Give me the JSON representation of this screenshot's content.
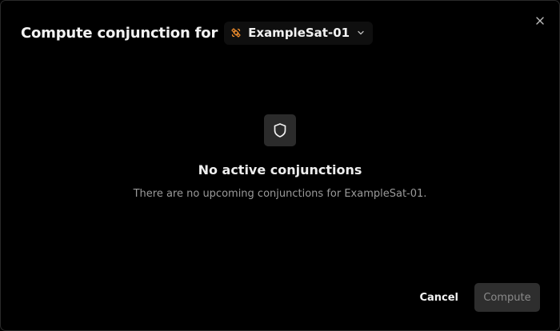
{
  "dialog": {
    "title": "Compute conjunction for",
    "satellite_select": {
      "value": "ExampleSat-01",
      "icon": "satellite-icon",
      "icon_color": "#e8892b"
    },
    "close_icon": "close-icon"
  },
  "empty_state": {
    "icon": "shield-icon",
    "title": "No active conjunctions",
    "description": "There are no upcoming conjunctions for ExampleSat-01."
  },
  "footer": {
    "cancel_label": "Cancel",
    "compute_label": "Compute",
    "compute_disabled": true
  }
}
